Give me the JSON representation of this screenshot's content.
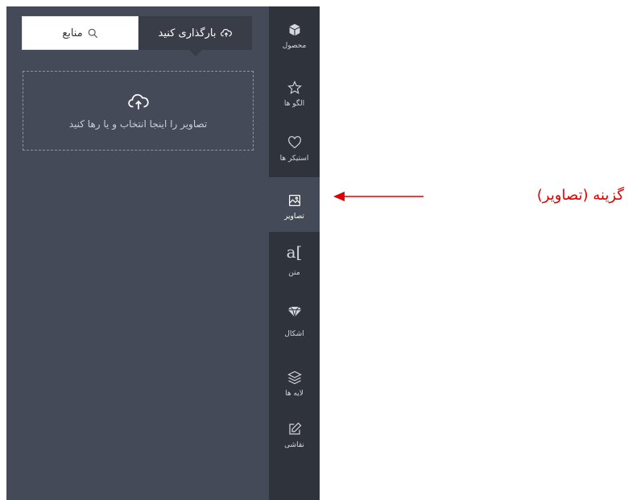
{
  "panel": {
    "tabs": {
      "upload_label": "بارگذاری کنید",
      "sources_label": "منابع"
    },
    "dropzone_text": "تصاویر را اینجا انتخاب و یا رها کنید"
  },
  "sidebar": {
    "items": [
      {
        "label": "محصول",
        "icon": "cube-icon"
      },
      {
        "label": "الگو ها",
        "icon": "star-icon"
      },
      {
        "label": "استیکر ها",
        "icon": "heart-icon"
      },
      {
        "label": "تصاویر",
        "icon": "image-icon",
        "active": true
      },
      {
        "label": "متن",
        "icon": "text-icon"
      },
      {
        "label": "اشکال",
        "icon": "diamond-icon"
      },
      {
        "label": "لایه ها",
        "icon": "layers-icon"
      },
      {
        "label": "نقاشی",
        "icon": "edit-icon"
      }
    ]
  },
  "annotation": {
    "text": "گزینه (تصاویر)",
    "color": "#e00000"
  },
  "colors": {
    "panel_bg": "#444a57",
    "sidebar_bg": "#2f333b",
    "active_tab_bg": "#383d47"
  }
}
